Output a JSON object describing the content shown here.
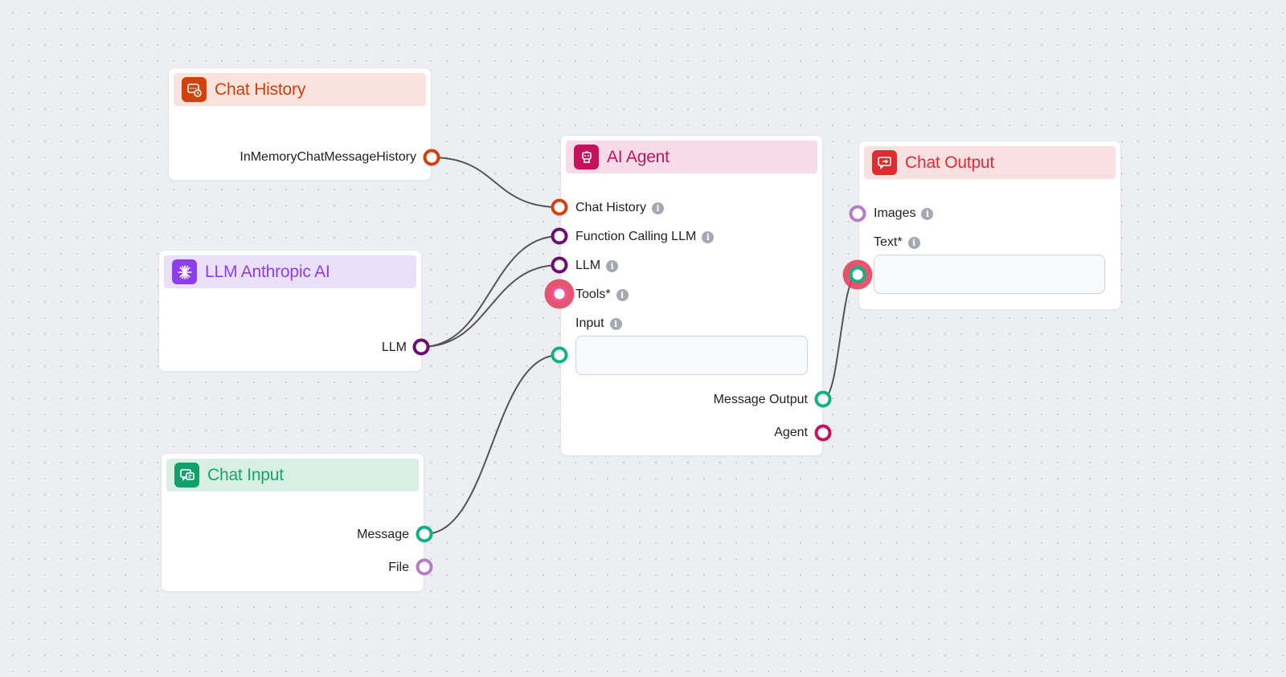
{
  "colors": {
    "orange": "#d1410c",
    "purple": "#6a0f6f",
    "green": "#12b085",
    "lilac": "#b47fc0",
    "crimson": "#c3135d",
    "pink": "#f0539a",
    "edge": "#555555",
    "ring": "#e23a56"
  },
  "nodes": {
    "chat_history": {
      "title": "Chat History",
      "icon": "message-history-icon",
      "header_bg": "#f9e3dc",
      "icon_bg": "#d1410c",
      "title_color": "#c94012",
      "output_label": "InMemoryChatMessageHistory"
    },
    "llm_anthropic": {
      "title": "LLM Anthropic AI",
      "icon": "anthropic-burst-icon",
      "header_bg": "#ebe0fb",
      "icon_bg": "#8c3ef0",
      "title_color": "#8c3ef0",
      "output_label": "LLM"
    },
    "chat_input": {
      "title": "Chat Input",
      "icon": "chat-input-icon",
      "header_bg": "#d9efe6",
      "icon_bg": "#14a06e",
      "title_color": "#16a36f",
      "outputs": [
        "Message",
        "File"
      ]
    },
    "ai_agent": {
      "title": "AI Agent",
      "icon": "robot-icon",
      "header_bg": "#f7dce7",
      "icon_bg": "#c3135d",
      "title_color": "#c3135d",
      "inputs": [
        "Chat History",
        "Function Calling LLM",
        "LLM",
        "Tools*",
        "Input"
      ],
      "input_value": "",
      "outputs": [
        "Message Output",
        "Agent"
      ]
    },
    "chat_output": {
      "title": "Chat Output",
      "icon": "chat-output-icon",
      "header_bg": "#fbe0e1",
      "icon_bg": "#e02b30",
      "title_color": "#dd2b32",
      "inputs": [
        "Images",
        "Text*"
      ],
      "text_value": ""
    }
  }
}
